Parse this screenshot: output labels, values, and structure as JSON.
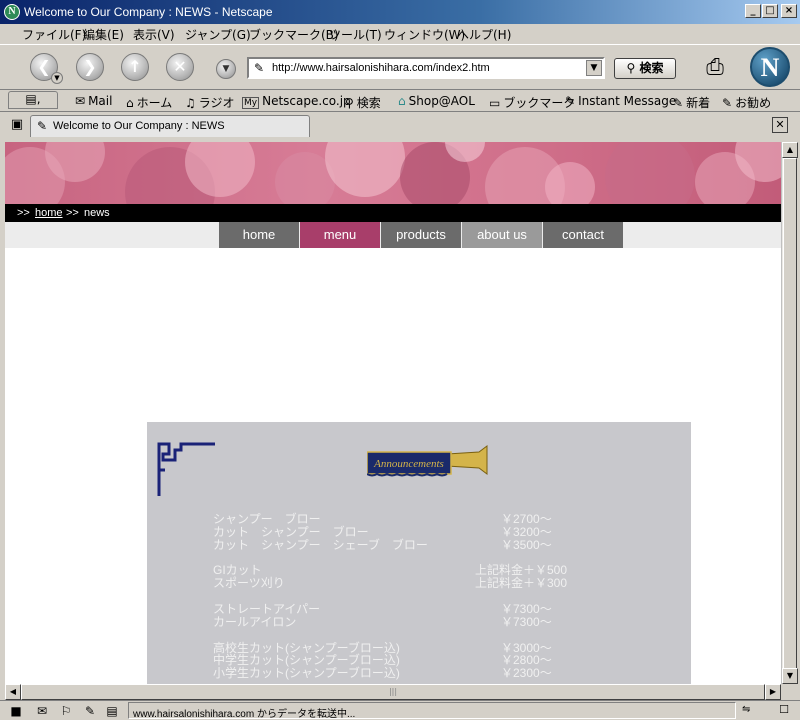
{
  "window": {
    "title": "Welcome to Our Company : NEWS - Netscape",
    "app_icon": "N",
    "controls": [
      "_",
      "□",
      "×"
    ]
  },
  "menubar": {
    "items": [
      {
        "label": "ファイル(F)"
      },
      {
        "label": "編集(E)"
      },
      {
        "label": "表示(V)"
      },
      {
        "label": "ジャンプ(G)"
      },
      {
        "label": "ブックマーク(B)"
      },
      {
        "label": "ツール(T)"
      },
      {
        "label": "ウィンドウ(W)"
      },
      {
        "label": "ヘルプ(H)"
      }
    ]
  },
  "navbar": {
    "back_icon": "arrow-left-icon",
    "forward_icon": "arrow-right-icon",
    "reload_icon": "reload-icon",
    "stop_icon": "stop-icon",
    "url": "http://www.hairsalonishihara.com/index2.htm",
    "search_label": "検索"
  },
  "personal_toolbar": {
    "items": [
      {
        "label": "Mail",
        "icon": "envelope-icon",
        "glyph": "✉"
      },
      {
        "label": "ホーム",
        "icon": "home-icon",
        "glyph": "⌂"
      },
      {
        "label": "ラジオ",
        "icon": "headphones-icon",
        "glyph": "♫"
      },
      {
        "label": "Netscape.co.jp",
        "icon": "my-netscape-icon",
        "glyph": "My"
      },
      {
        "label": "検索",
        "icon": "search-icon",
        "glyph": "🔍"
      },
      {
        "label": "Shop@AOL",
        "icon": "shop-icon",
        "glyph": "⌂"
      },
      {
        "label": "ブックマーク",
        "icon": "bookmark-folder-icon",
        "glyph": "▭"
      },
      {
        "label": "Instant Message",
        "icon": "bookmark-icon",
        "glyph": "✎"
      },
      {
        "label": "新着",
        "icon": "bookmark-icon",
        "glyph": "✎"
      },
      {
        "label": "お勧め",
        "icon": "bookmark-icon",
        "glyph": "✎"
      }
    ]
  },
  "tabs": {
    "active_label": "Welcome to Our Company : NEWS"
  },
  "page": {
    "breadcrumb": {
      "sep": ">>",
      "home": "home",
      "current": "news"
    },
    "nav": [
      {
        "label": "home",
        "color": "#6b6b6b"
      },
      {
        "label": "menu",
        "color": "#a83e6a"
      },
      {
        "label": "products",
        "color": "#6b6b6b"
      },
      {
        "label": "about us",
        "color": "#9a9a9a"
      },
      {
        "label": "contact",
        "color": "#6b6b6b"
      }
    ],
    "banner_label": "Announcements",
    "price_groups": [
      [
        {
          "name": "シャンプー　ブロー",
          "price": "￥2700〜"
        },
        {
          "name": "カット　シャンプー　ブロー",
          "price": "￥3200〜"
        },
        {
          "name": "カット　シャンプー　シェーブ　ブロー",
          "price": "￥3500〜"
        }
      ],
      [
        {
          "name": "GIカット",
          "price": "上記料金＋￥500"
        },
        {
          "name": "スポーツ刈り",
          "price": "上記料金＋￥300"
        }
      ],
      [
        {
          "name": "ストレートアイパー",
          "price": "￥7300〜"
        },
        {
          "name": "カールアイロン",
          "price": "￥7300〜"
        }
      ],
      [
        {
          "name": "高校生カット(シャンプーブロー込)",
          "price": "￥3000〜"
        },
        {
          "name": "中学生カット(シャンプーブロー込)",
          "price": "￥2800〜"
        },
        {
          "name": "小学生カット(シャンプーブロー込)",
          "price": "￥2300〜"
        }
      ]
    ]
  },
  "status": {
    "text": "www.hairsalonishihara.com からデータを転送中..."
  },
  "colors": {
    "banner": "#c76480",
    "panel": "#c8c8cc",
    "accent": "#a83e6a"
  }
}
